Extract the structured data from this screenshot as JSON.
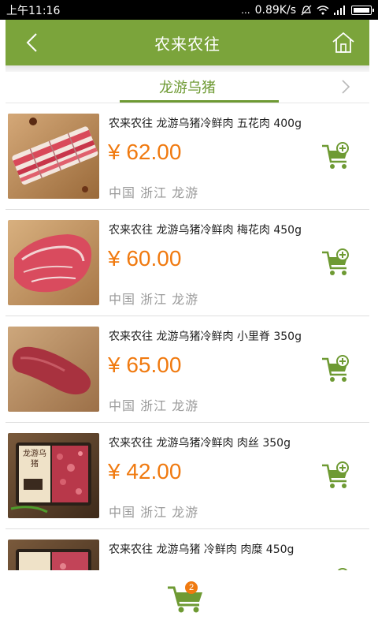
{
  "status_bar": {
    "time": "上午11:16",
    "network_speed": "0.89K/s",
    "dots": "..."
  },
  "header": {
    "title": "农来农往"
  },
  "category": {
    "title": "龙游乌猪"
  },
  "products": [
    {
      "name": "农来农往 龙游乌猪冷鲜肉 五花肉 400g",
      "price": "¥ 62.00",
      "origin": "中国 浙江 龙游"
    },
    {
      "name": "农来农往 龙游乌猪冷鲜肉 梅花肉 450g",
      "price": "¥ 60.00",
      "origin": "中国 浙江 龙游"
    },
    {
      "name": "农来农往 龙游乌猪冷鲜肉 小里脊 350g",
      "price": "¥ 65.00",
      "origin": "中国 浙江 龙游"
    },
    {
      "name": "农来农往 龙游乌猪冷鲜肉 肉丝 350g",
      "price": "¥ 42.00",
      "origin": "中国 浙江 龙游"
    },
    {
      "name": "农来农往 龙游乌猪 冷鲜肉 肉糜 450g",
      "price": "",
      "origin": ""
    }
  ],
  "package_label": "龙游乌猪",
  "cart": {
    "count": "2"
  },
  "colors": {
    "brand_green": "#7ba43b",
    "accent_green": "#6e9a33",
    "price_orange": "#f07a10"
  },
  "icons": {
    "back": "chevron-left-icon",
    "home": "home-icon",
    "next": "chevron-right-icon",
    "add_cart": "add-to-cart-icon",
    "cart": "shopping-cart-icon"
  }
}
